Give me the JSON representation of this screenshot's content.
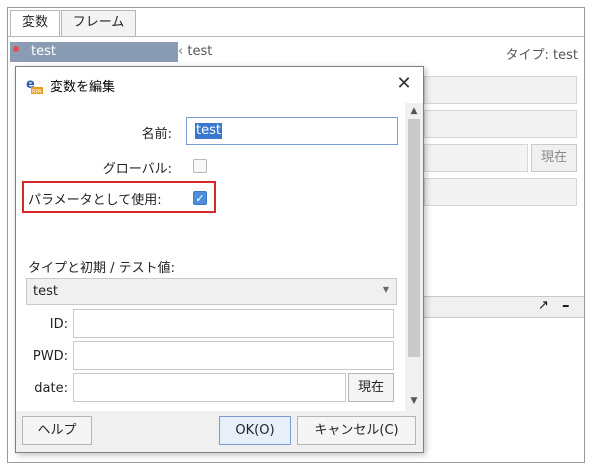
{
  "tabs": [
    {
      "label": "変数"
    },
    {
      "label": "フレーム"
    }
  ],
  "variable_list": {
    "selected_item": "test"
  },
  "detail_header": {
    "name": "test",
    "type_label": "タイプ: test"
  },
  "background_buttons": {
    "now_label": "現在"
  },
  "dialog": {
    "title": "変数を編集",
    "name_label": "名前:",
    "name_value": "test",
    "global_label": "グローバル:",
    "global_checked": false,
    "use_as_param_label": "パラメータとして使用:",
    "use_as_param_checked": true,
    "type_init_label": "タイプと初期 / テスト値:",
    "type_value": "test",
    "fields": [
      {
        "label": "ID:",
        "value": ""
      },
      {
        "label": "PWD:",
        "value": ""
      },
      {
        "label": "date:",
        "value": ""
      }
    ],
    "now_button": "現在",
    "help_button": "ヘルプ",
    "ok_button": "OK(O)",
    "cancel_button": "キャンセル(C)"
  },
  "colors": {
    "highlight_border": "#d8282b",
    "selection": "#3a78d0",
    "list_selection": "#8a9bb4"
  }
}
